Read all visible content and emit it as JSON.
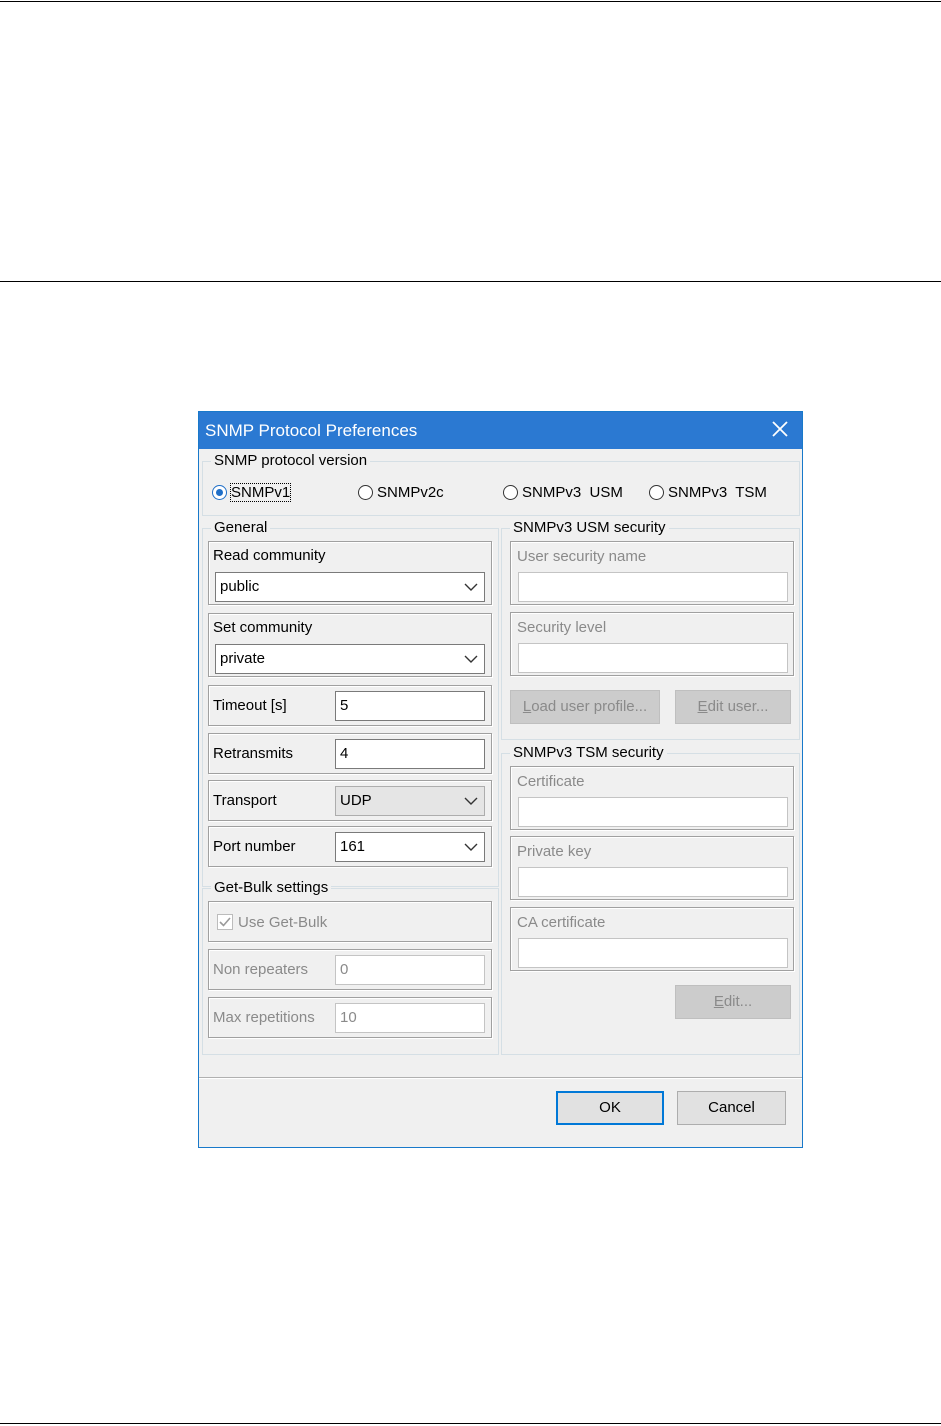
{
  "dialog": {
    "title": "SNMP Protocol Preferences",
    "version_group": {
      "label": "SNMP protocol version",
      "options": [
        "SNMPv1",
        "SNMPv2c",
        "SNMPv3  USM",
        "SNMPv3  TSM"
      ],
      "selected": "SNMPv1"
    },
    "general": {
      "label": "General",
      "read_community_label": "Read community",
      "read_community_value": "public",
      "set_community_label": "Set community",
      "set_community_value": "private",
      "timeout_label": "Timeout [s]",
      "timeout_value": "5",
      "retransmits_label": "Retransmits",
      "retransmits_value": "4",
      "transport_label": "Transport",
      "transport_value": "UDP",
      "port_label": "Port number",
      "port_value": "161"
    },
    "getbulk": {
      "label": "Get-Bulk settings",
      "use_label": "Use Get-Bulk",
      "use_checked": true,
      "non_repeaters_label": "Non repeaters",
      "non_repeaters_value": "0",
      "max_repetitions_label": "Max repetitions",
      "max_repetitions_value": "10"
    },
    "usm": {
      "label": "SNMPv3 USM security",
      "user_name_label": "User security name",
      "user_name_value": "",
      "security_level_label": "Security level",
      "security_level_value": "",
      "load_profile_label": "Load user profile...",
      "load_profile_mnemonic": "L",
      "load_profile_rest": "oad user profile...",
      "edit_user_label": "Edit user...",
      "edit_user_mnemonic": "E",
      "edit_user_rest": "dit user..."
    },
    "tsm": {
      "label": "SNMPv3 TSM security",
      "certificate_label": "Certificate",
      "certificate_value": "",
      "private_key_label": "Private key",
      "private_key_value": "",
      "ca_certificate_label": "CA certificate",
      "ca_certificate_value": "",
      "edit_label": "Edit...",
      "edit_mnemonic": "E",
      "edit_rest": "dit..."
    },
    "ok_label": "OK",
    "cancel_label": "Cancel"
  },
  "colors": {
    "titlebar": "#2b79d2",
    "dialog_bg": "#f0f0f0",
    "accent": "#0078d7"
  }
}
